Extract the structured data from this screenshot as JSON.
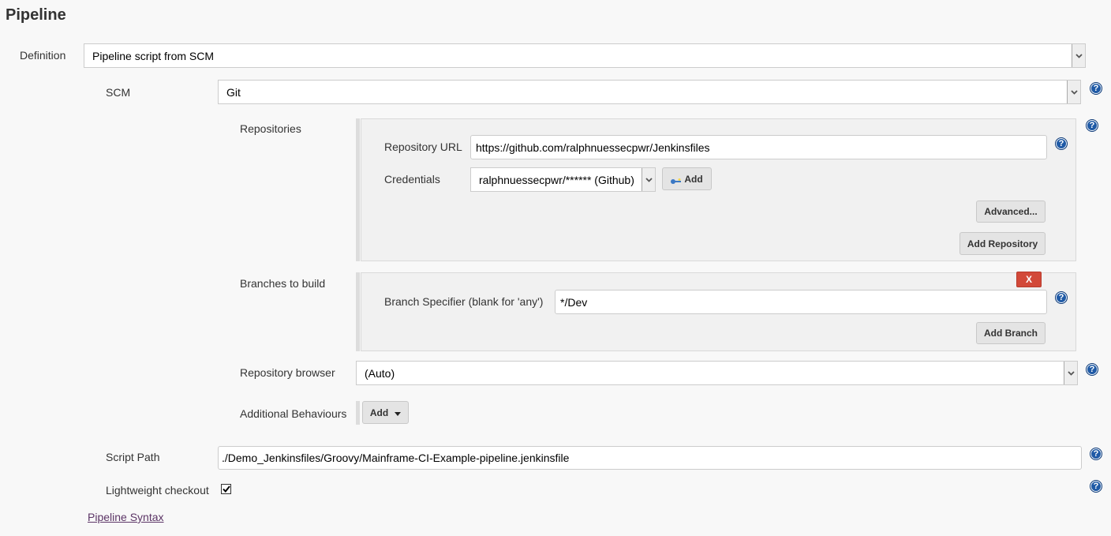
{
  "section": {
    "title": "Pipeline"
  },
  "definition": {
    "label": "Definition",
    "value": "Pipeline script from SCM"
  },
  "scm": {
    "label": "SCM",
    "value": "Git"
  },
  "repositories": {
    "label": "Repositories",
    "url_label": "Repository URL",
    "url_value": "https://github.com/ralphnuessecpwr/Jenkinsfiles",
    "credentials_label": "Credentials",
    "credentials_value": "ralphnuessecpwr/****** (Github)",
    "add_credentials_label": "Add",
    "advanced_label": "Advanced...",
    "add_repository_label": "Add Repository"
  },
  "branches": {
    "label": "Branches to build",
    "specifier_label": "Branch Specifier (blank for 'any')",
    "specifier_value": "*/Dev",
    "delete_label": "X",
    "add_branch_label": "Add Branch"
  },
  "repo_browser": {
    "label": "Repository browser",
    "value": "(Auto)"
  },
  "behaviours": {
    "label": "Additional Behaviours",
    "add_label": "Add"
  },
  "script_path": {
    "label": "Script Path",
    "value": "./Demo_Jenkinsfiles/Groovy/Mainframe-CI-Example-pipeline.jenkinsfile"
  },
  "lightweight": {
    "label": "Lightweight checkout",
    "checked": true
  },
  "links": {
    "pipeline_syntax": "Pipeline Syntax"
  },
  "help": {
    "glyph": "?"
  }
}
